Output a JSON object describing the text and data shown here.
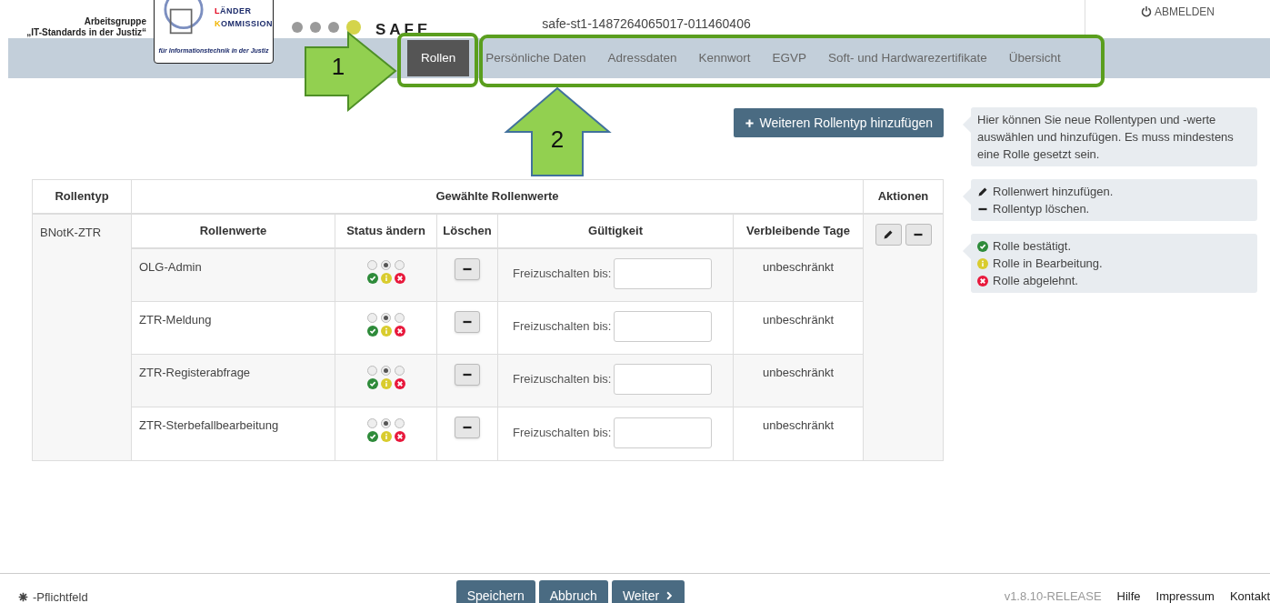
{
  "header": {
    "org_lines": [
      "Arbeitsgruppe",
      "„IT-Standards in der Justiz“"
    ],
    "logo": {
      "words": [
        {
          "text": "LÄNDER",
          "color": "#e2001a"
        },
        {
          "text": "KOMMISSION",
          "color": "#f0b400"
        }
      ],
      "subtitle": "für Informationstechnik in der Justiz"
    },
    "step_dots": [
      {
        "active": false
      },
      {
        "active": false
      },
      {
        "active": false
      },
      {
        "active": true
      }
    ],
    "app_name": "SAFE",
    "session_id": "safe-st1-1487264065017-011460406",
    "logout": "ABMELDEN"
  },
  "tabs": [
    {
      "label": "Rollen",
      "selected": true
    },
    {
      "label": "Persönliche Daten",
      "selected": false
    },
    {
      "label": "Adressdaten",
      "selected": false
    },
    {
      "label": "Kennwort",
      "selected": false
    },
    {
      "label": "EGVP",
      "selected": false
    },
    {
      "label": "Soft- und Hardwarezertifikate",
      "selected": false
    },
    {
      "label": "Übersicht",
      "selected": false
    }
  ],
  "add_button": "Weiteren Rollentyp hinzufügen",
  "hints": [
    {
      "kind": "text",
      "text": "Hier können Sie neue Rollentypen und -werte auswählen und hinzufügen. Es muss mindestens eine Rolle gesetzt sein."
    },
    {
      "kind": "legend",
      "items": [
        {
          "kind": "pencil",
          "text": "Rollenwert hinzufügen."
        },
        {
          "kind": "minus",
          "text": "Rollentyp löschen."
        }
      ]
    },
    {
      "kind": "legend",
      "items": [
        {
          "kind": "check",
          "text": "Rolle bestätigt."
        },
        {
          "kind": "info",
          "text": "Rolle in Bearbeitung."
        },
        {
          "kind": "cross",
          "text": "Rolle abgelehnt."
        }
      ]
    }
  ],
  "table": {
    "columns": [
      "Rollentyp",
      "Gewählte Rollenwerte",
      "Aktionen"
    ],
    "role_type": "BNotK-ZTR",
    "inner_columns": [
      "Rollenwerte",
      "Status ändern",
      "Löschen",
      "Gültigkeit",
      "Verbleibende Tage"
    ],
    "rows": [
      {
        "value": "OLG-Admin",
        "status": [
          {
            "selected": false
          },
          {
            "selected": true
          },
          {
            "selected": false
          }
        ],
        "validity_label": "Freizuschalten bis:",
        "remaining": "unbeschränkt"
      },
      {
        "value": "ZTR-Meldung",
        "status": [
          {
            "selected": false
          },
          {
            "selected": true
          },
          {
            "selected": false
          }
        ],
        "validity_label": "Freizuschalten bis:",
        "remaining": "unbeschränkt"
      },
      {
        "value": "ZTR-Registerabfrage",
        "status": [
          {
            "selected": false
          },
          {
            "selected": true
          },
          {
            "selected": false
          }
        ],
        "validity_label": "Freizuschalten bis:",
        "remaining": "unbeschränkt"
      },
      {
        "value": "ZTR-Sterbefallbearbeitung",
        "status": [
          {
            "selected": false
          },
          {
            "selected": true
          },
          {
            "selected": false
          }
        ],
        "validity_label": "Freizuschalten bis:",
        "remaining": "unbeschränkt"
      }
    ]
  },
  "footer": {
    "required_note": "-Pflichtfeld",
    "buttons": [
      {
        "label": "Speichern",
        "kind": "plain"
      },
      {
        "label": "Abbruch",
        "kind": "plain"
      },
      {
        "label": "Weiter",
        "kind": "next"
      }
    ],
    "version": "v1.8.10-RELEASE",
    "links": [
      "Hilfe",
      "Impressum",
      "Kontakt"
    ]
  },
  "annotations": [
    {
      "kind": "arrow-right",
      "label": "1"
    },
    {
      "kind": "arrow-up",
      "label": "2"
    }
  ]
}
